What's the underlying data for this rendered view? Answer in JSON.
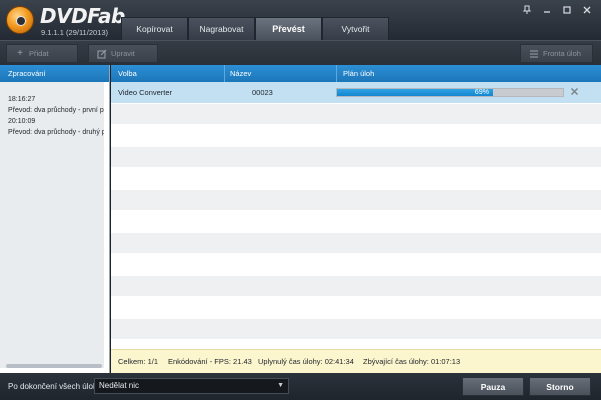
{
  "app": {
    "name": "DVDFab",
    "version": "9.1.1.1 (29/11/2013)"
  },
  "tabs": [
    {
      "label": "Kopírovat",
      "active": false
    },
    {
      "label": "Nagrabovat",
      "active": false
    },
    {
      "label": "Převést",
      "active": true
    },
    {
      "label": "Vytvořit",
      "active": false
    }
  ],
  "window_controls": {
    "pin": "pin-icon",
    "minimize": "minimize-icon",
    "maximize": "maximize-icon",
    "close": "close-icon"
  },
  "toolbar": {
    "add_label": "Přidat",
    "edit_label": "Upravit",
    "queue_label": "Fronta úloh"
  },
  "left_panel": {
    "header": "Zpracování",
    "log": [
      "18:16:27",
      "Převod: dva průchody - první průc",
      "20:10:09",
      "Převod: dva průchody - druhý průc"
    ]
  },
  "main": {
    "columns": {
      "option": "Volba",
      "name": "Název",
      "task_plan": "Plán úloh"
    },
    "tasks": [
      {
        "option": "Video Converter",
        "name": "00023",
        "progress_percent": 69,
        "progress_label": "69%"
      }
    ],
    "status": {
      "total": "Celkem: 1/1",
      "fps": "Enkódování - FPS: 21.43",
      "elapsed": "Uplynulý čas úlohy: 02:41:34",
      "remaining": "Zbývající čas úlohy: 01:07:13"
    }
  },
  "bottom": {
    "after_label": "Po dokončení všech úloh:",
    "after_value": "Nedělat nic",
    "pause_label": "Pauza",
    "cancel_label": "Storno"
  },
  "colors": {
    "accent_blue": "#1f7fc4",
    "progress_fill": "#1a90d8",
    "status_bg": "#fcf6cf",
    "selected_row": "#c3e0f3"
  }
}
